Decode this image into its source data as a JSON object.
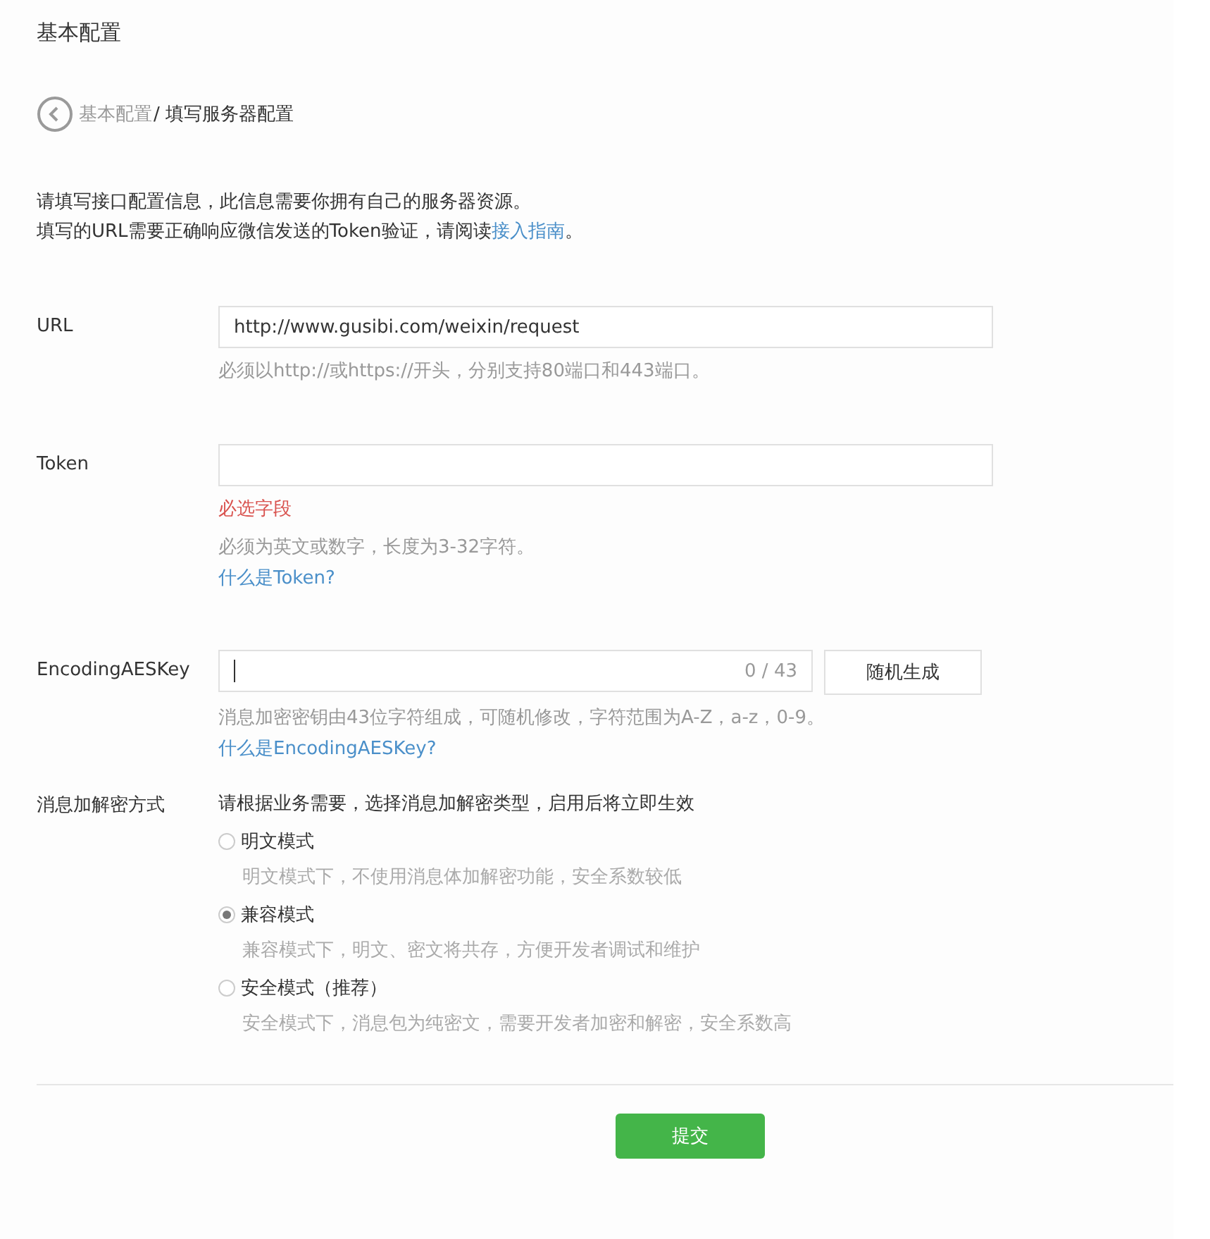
{
  "page_title": "基本配置",
  "breadcrumb": {
    "parent": "基本配置",
    "separator": "/",
    "current": "填写服务器配置"
  },
  "intro": {
    "line_1": "请填写接口配置信息，此信息需要你拥有自己的服务器资源。",
    "line_2": "填写的URL需要正确响应微信发送的Token验证，请阅读",
    "link": "接入指南",
    "line_2_end": "。"
  },
  "fields": [
    {
      "label": "URL",
      "kind": "text",
      "value": "http://www.gusibi.com/weixin/request",
      "hint": "必须以http://或https://开头，分别支持80端口和443端口。"
    },
    {
      "label": "Token",
      "kind": "text",
      "error": "必选字段",
      "hint": "必须为英文或数字，长度为3-32字符。",
      "link": "什么是Token?"
    },
    {
      "label": "EncodingAESKey",
      "kind": "key",
      "counter": "0 / 43",
      "button": "随机生成",
      "hint": "消息加密密钥由43位字符组成，可随机修改，字符范围为A-Z，a-z，0-9。",
      "link": "什么是EncodingAESKey?"
    }
  ],
  "encryption": {
    "label": "消息加解密方式",
    "instruction": "请根据业务需要，选择消息加解密类型，启用后将立即生效",
    "options": [
      {
        "label": "明文模式",
        "description": "明文模式下，不使用消息体加解密功能，安全系数较低",
        "selected": false
      },
      {
        "label": "兼容模式",
        "description": "兼容模式下，明文、密文将共存，方便开发者调试和维护",
        "selected": true
      },
      {
        "label": "安全模式（推荐）",
        "description": "安全模式下，消息包为纯密文，需要开发者加密和解密，安全系数高",
        "selected": false
      }
    ]
  },
  "submit": "提交"
}
